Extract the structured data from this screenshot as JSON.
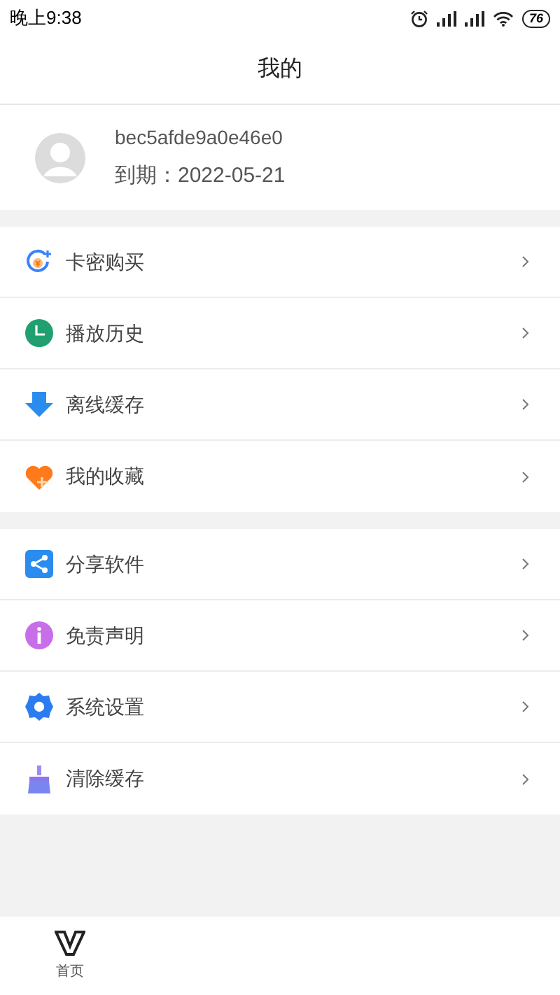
{
  "status_bar": {
    "time": "晚上9:38",
    "battery": "76"
  },
  "header": {
    "title": "我的"
  },
  "profile": {
    "username": "bec5afde9a0e46e0",
    "expiry": "到期：2022-05-21"
  },
  "menu_groups": [
    [
      {
        "label": "卡密购买",
        "kind": "coupon"
      },
      {
        "label": "播放历史",
        "kind": "clock"
      },
      {
        "label": "离线缓存",
        "kind": "download"
      },
      {
        "label": "我的收藏",
        "kind": "heart"
      }
    ],
    [
      {
        "label": "分享软件",
        "kind": "share"
      },
      {
        "label": "免责声明",
        "kind": "info"
      },
      {
        "label": "系统设置",
        "kind": "gear"
      },
      {
        "label": "清除缓存",
        "kind": "broom"
      }
    ]
  ],
  "bottom_nav": [
    {
      "label": "首页"
    }
  ]
}
